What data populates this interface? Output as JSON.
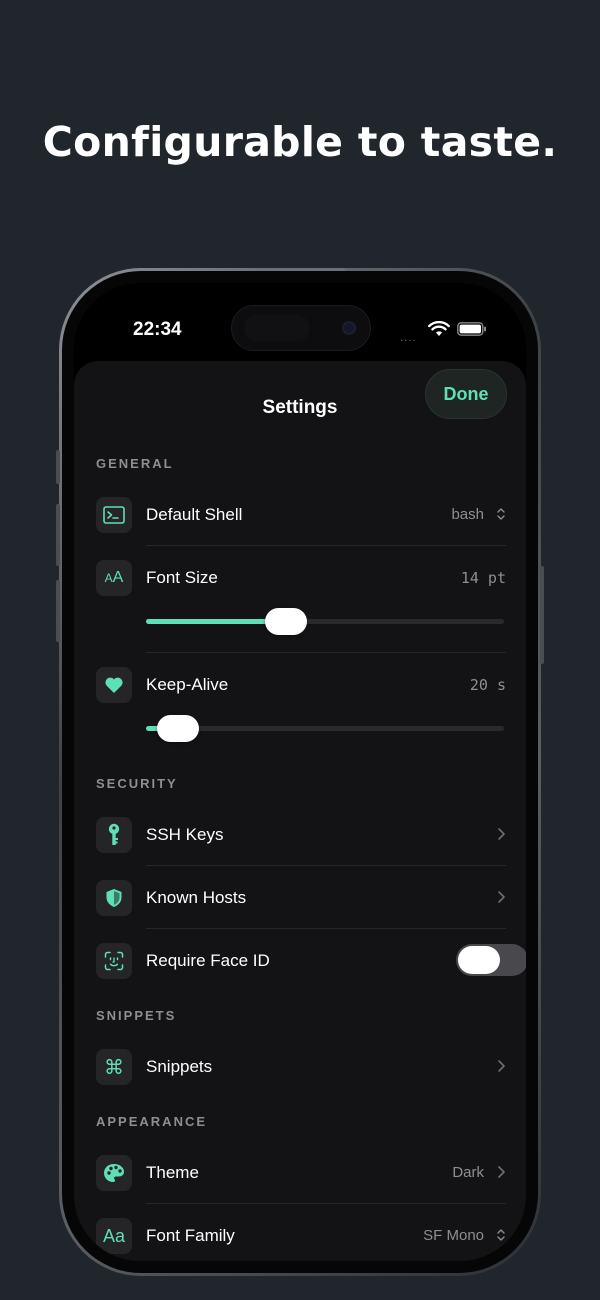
{
  "headline": "Configurable to taste.",
  "status_bar": {
    "time": "22:34",
    "dots": "....",
    "wifi_icon": "wifi-icon",
    "battery_icon": "battery-icon"
  },
  "header": {
    "title": "Settings",
    "done_label": "Done"
  },
  "colors": {
    "accent": "#5fdfb4",
    "background": "#21252c",
    "sheet": "#131315"
  },
  "sections": {
    "general": {
      "title": "GENERAL",
      "default_shell": {
        "label": "Default Shell",
        "value": "bash",
        "icon": "terminal-icon"
      },
      "font_size": {
        "label": "Font Size",
        "value": "14 pt",
        "icon": "text-size-icon",
        "icon_text": "AA",
        "slider_fraction": 0.39
      },
      "keep_alive": {
        "label": "Keep-Alive",
        "value": "20 s",
        "icon": "heart-icon",
        "slider_fraction": 0.09
      }
    },
    "security": {
      "title": "SECURITY",
      "ssh_keys": {
        "label": "SSH Keys",
        "icon": "key-icon"
      },
      "known_hosts": {
        "label": "Known Hosts",
        "icon": "shield-icon"
      },
      "require_face_id": {
        "label": "Require Face ID",
        "icon": "face-id-icon",
        "enabled": false
      }
    },
    "snippets": {
      "title": "SNIPPETS",
      "snippets": {
        "label": "Snippets",
        "icon": "command-icon",
        "icon_text": "⌘"
      }
    },
    "appearance": {
      "title": "APPEARANCE",
      "theme": {
        "label": "Theme",
        "value": "Dark",
        "icon": "palette-icon"
      },
      "font_family": {
        "label": "Font Family",
        "value": "SF Mono",
        "icon": "font-family-icon",
        "icon_text": "Aa"
      }
    }
  }
}
